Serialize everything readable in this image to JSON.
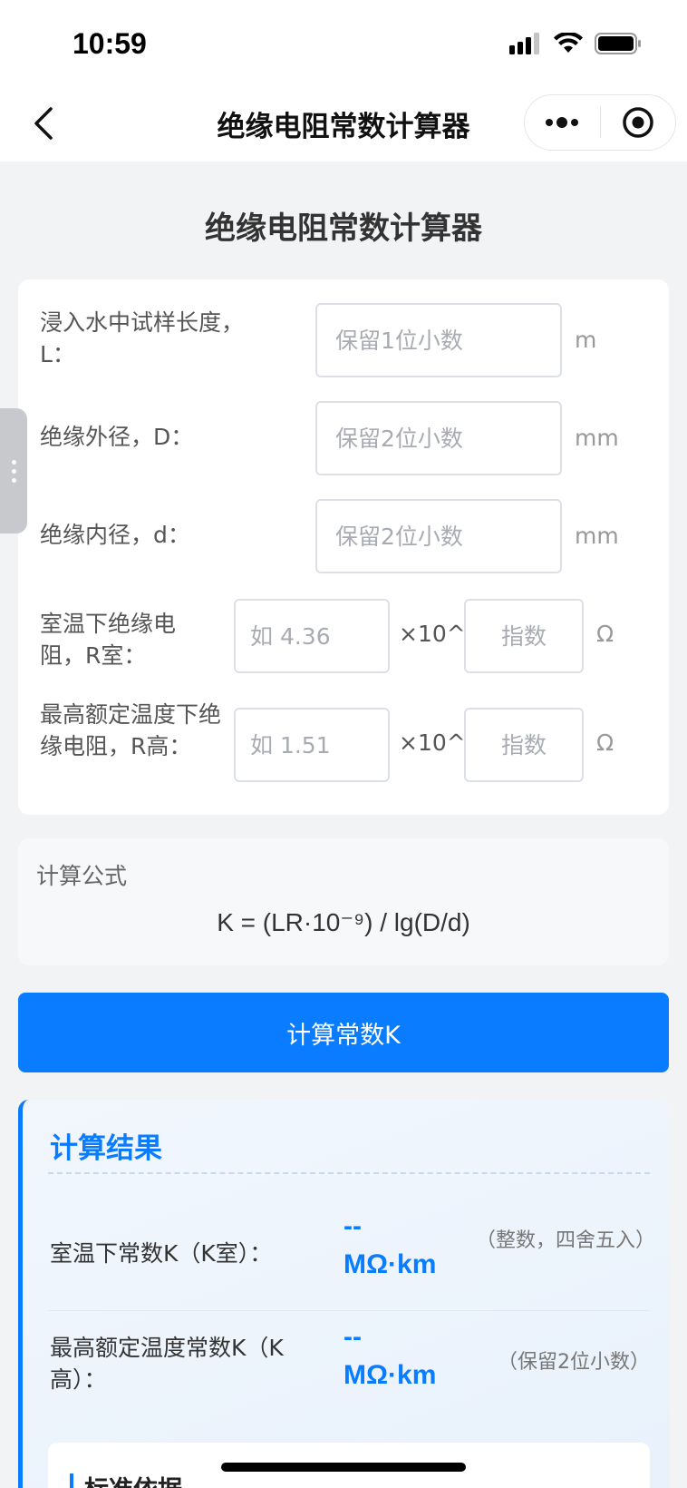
{
  "status_bar": {
    "time": "10:59"
  },
  "nav": {
    "title": "绝缘电阻常数计算器"
  },
  "page": {
    "title": "绝缘电阻常数计算器"
  },
  "form": {
    "length": {
      "label": "浸入水中试样长度，L：",
      "placeholder": "保留1位小数",
      "unit": "m"
    },
    "outer_diameter": {
      "label": "绝缘外径，D：",
      "placeholder": "保留2位小数",
      "unit": "mm"
    },
    "inner_diameter": {
      "label": "绝缘内径，d：",
      "placeholder": "保留2位小数",
      "unit": "mm"
    },
    "r_room": {
      "label": "室温下绝缘电阻，R室：",
      "mantissa_placeholder": "如 4.36",
      "times": "×10^",
      "exponent_placeholder": "指数",
      "unit": "Ω"
    },
    "r_high": {
      "label": "最高额定温度下绝缘电阻，R高：",
      "mantissa_placeholder": "如 1.51",
      "times": "×10^",
      "exponent_placeholder": "指数",
      "unit": "Ω"
    }
  },
  "formula": {
    "label": "计算公式",
    "text": "K = (LR·10⁻⁹) / lg(D/d)"
  },
  "calc_button": {
    "label": "计算常数K"
  },
  "results": {
    "title": "计算结果",
    "k_room": {
      "label": "室温下常数K（K室）：",
      "value": "--",
      "unit": "MΩ·km",
      "note": "（整数，四舍五入）"
    },
    "k_high": {
      "label": "最高额定温度常数K（K高）：",
      "value": "--",
      "unit": "MΩ·km",
      "note": "（保留2位小数）"
    }
  },
  "standard": {
    "title": "标准依据"
  },
  "colors": {
    "primary": "#0a7cff",
    "background": "#f2f3f5"
  }
}
